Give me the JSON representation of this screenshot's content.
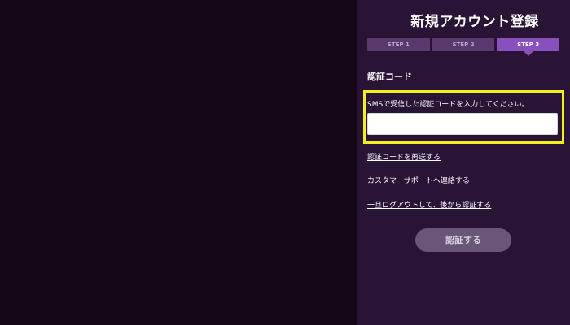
{
  "panel": {
    "title": "新規アカウント登録"
  },
  "steps": [
    {
      "label": "STEP 1",
      "active": false
    },
    {
      "label": "STEP 2",
      "active": false
    },
    {
      "label": "STEP 3",
      "active": true
    }
  ],
  "verification": {
    "heading": "認証コード",
    "instruction": "SMSで受信した認証コードを入力してください。",
    "input_value": "",
    "input_placeholder": ""
  },
  "links": {
    "resend": "認証コードを再送する",
    "support": "カスタマーサポートへ連絡する",
    "logout": "一旦ログアウトして、後から認証する"
  },
  "actions": {
    "submit_label": "認証する"
  },
  "colors": {
    "background": "#140612",
    "panel": "#2a1436",
    "step_inactive": "#5a3a6e",
    "step_active": "#8a4fbf",
    "highlight": "#f4ee1c",
    "button": "#6a5676"
  }
}
